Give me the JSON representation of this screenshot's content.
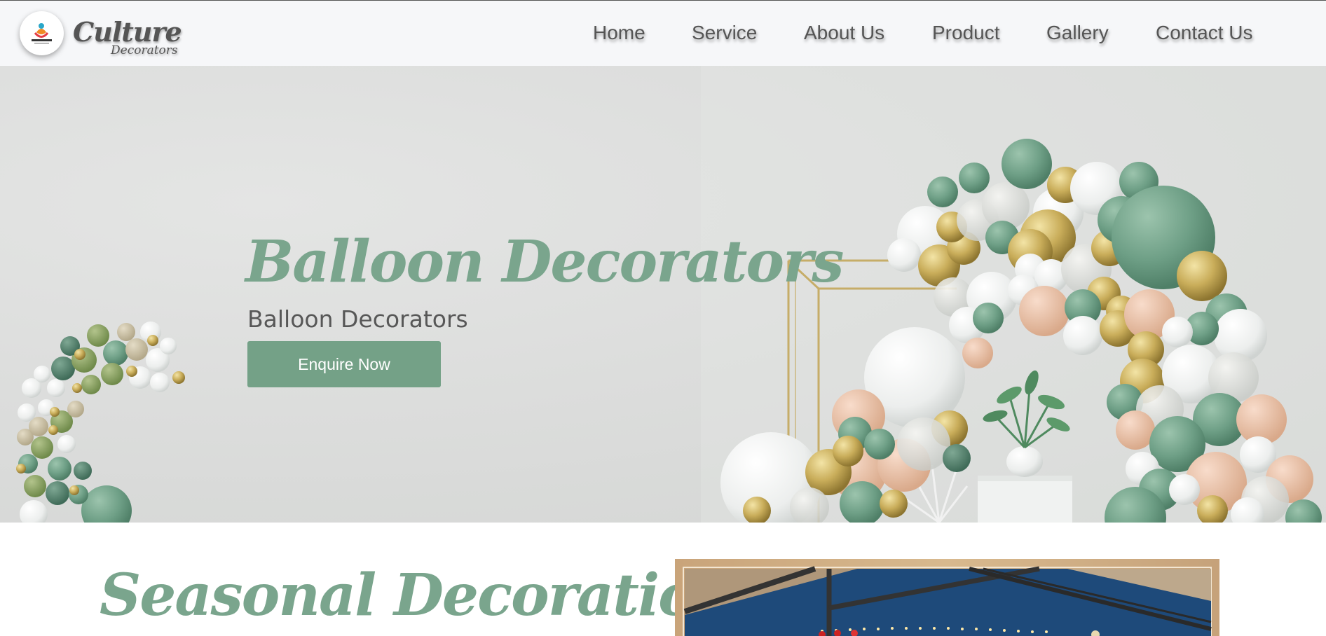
{
  "brand": {
    "name_line1": "Culture",
    "name_line2": "Decorators",
    "logo_text": "Culture Logo"
  },
  "nav": {
    "items": [
      {
        "label": "Home"
      },
      {
        "label": "Service"
      },
      {
        "label": "About Us"
      },
      {
        "label": "Product"
      },
      {
        "label": "Gallery"
      },
      {
        "label": "Contact Us"
      }
    ]
  },
  "hero": {
    "title": "Balloon Decorators",
    "subtitle": "Balloon Decorators",
    "cta_label": "Enquire Now",
    "accent_color": "#74a187"
  },
  "seasonal": {
    "title": "Seasonal Decoration"
  },
  "colors": {
    "header_bg": "#f6f7f9",
    "nav_text": "#555555",
    "title_green": "#7aa58d",
    "balloon_green": "#6e9f86",
    "balloon_gold": "#c9ad5a",
    "balloon_peach": "#e9c4ab"
  }
}
